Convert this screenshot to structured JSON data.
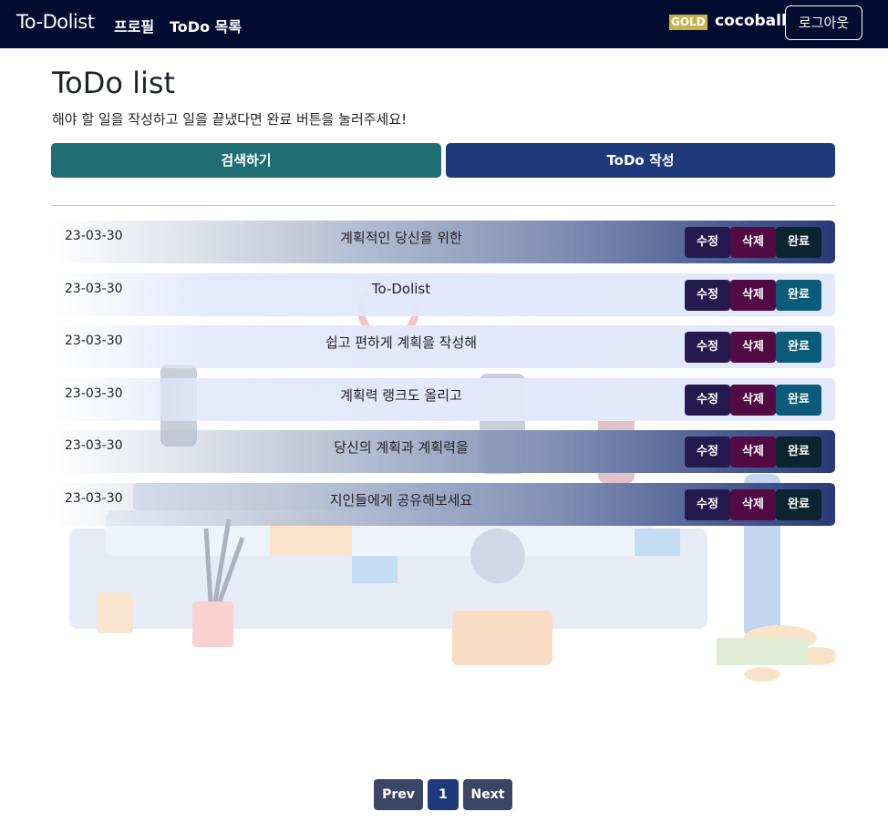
{
  "nav": {
    "brand": "To-Dolist",
    "profile": "프로필",
    "todo_list": "ToDo 목록",
    "grade": "GOLD",
    "username": "cocoball",
    "logout": "로그아웃"
  },
  "page": {
    "title": "ToDo list",
    "description": "해야 할 일을 작성하고 일을 끝냈다면 완료 버튼을 눌러주세요!",
    "search_button": "검색하기",
    "write_button": "ToDo 작성"
  },
  "todos": [
    {
      "date": "23-03-30",
      "title": "계획적인 당신을 위한",
      "edit": "수정",
      "delete": "삭제",
      "done": "완료"
    },
    {
      "date": "23-03-30",
      "title": "To-Dolist",
      "edit": "수정",
      "delete": "삭제",
      "done": "완료"
    },
    {
      "date": "23-03-30",
      "title": "쉽고 편하게 계획을 작성해",
      "edit": "수정",
      "delete": "삭제",
      "done": "완료"
    },
    {
      "date": "23-03-30",
      "title": "계획력 랭크도 올리고",
      "edit": "수정",
      "delete": "삭제",
      "done": "완료"
    },
    {
      "date": "23-03-30",
      "title": "당신의 계획과 계획력을",
      "edit": "수정",
      "delete": "삭제",
      "done": "완료"
    },
    {
      "date": "23-03-30",
      "title": "지인들에게 공유해보세요",
      "edit": "수정",
      "delete": "삭제",
      "done": "완료"
    }
  ],
  "pagination": {
    "prev": "Prev",
    "current": "1",
    "next": "Next"
  },
  "colors": {
    "navbar": "#020b30",
    "search_button": "#1e6e74",
    "write_button": "#1e3a7a",
    "grade_badge": "#c8b34a"
  }
}
